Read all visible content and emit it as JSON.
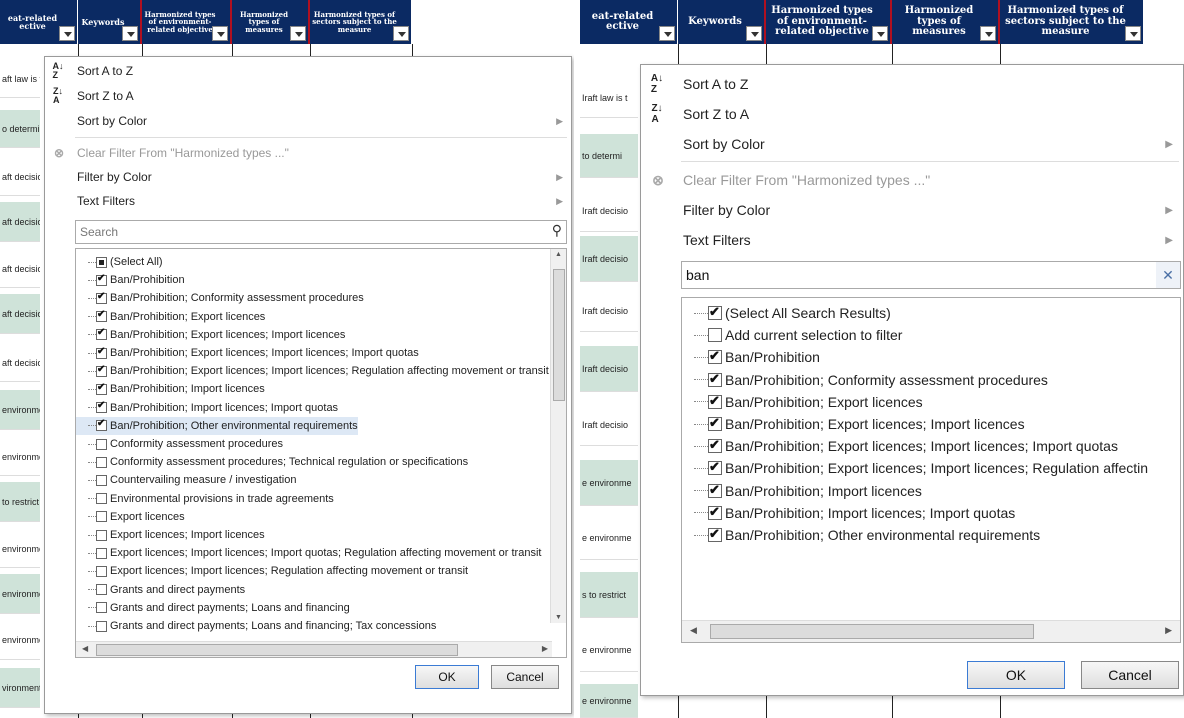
{
  "columns": [
    "eat-related ective",
    "Keywords",
    "Harmonized types of environment-related objective",
    "Harmonized types of measures",
    "Harmonized types of sectors subject to the measure"
  ],
  "left": {
    "rows": [
      "aft law is t",
      "o determi",
      "aft decisio",
      "aft decisio",
      "aft decisio",
      "aft decisio",
      "aft decisio",
      "environme",
      "environme",
      "to restrict",
      "environme",
      "environme",
      "environme",
      "vironment"
    ],
    "menu": {
      "sort_az": "Sort A to Z",
      "sort_za": "Sort Z to A",
      "sort_color": "Sort by Color",
      "clear": "Clear Filter From \"Harmonized types ...\"",
      "filter_color": "Filter by Color",
      "text_filters": "Text Filters",
      "search_placeholder": "Search",
      "items": [
        {
          "label": "(Select All)",
          "state": "partial"
        },
        {
          "label": "Ban/Prohibition",
          "state": "on"
        },
        {
          "label": "Ban/Prohibition; Conformity assessment procedures",
          "state": "on"
        },
        {
          "label": "Ban/Prohibition; Export licences",
          "state": "on"
        },
        {
          "label": "Ban/Prohibition; Export licences; Import licences",
          "state": "on"
        },
        {
          "label": "Ban/Prohibition; Export licences; Import licences; Import quotas",
          "state": "on"
        },
        {
          "label": "Ban/Prohibition; Export licences; Import licences; Regulation affecting movement or transit",
          "state": "on"
        },
        {
          "label": "Ban/Prohibition; Import licences",
          "state": "on"
        },
        {
          "label": "Ban/Prohibition; Import licences; Import quotas",
          "state": "on"
        },
        {
          "label": "Ban/Prohibition; Other environmental requirements",
          "state": "on"
        },
        {
          "label": "Conformity assessment procedures",
          "state": "off"
        },
        {
          "label": "Conformity assessment procedures; Technical regulation or specifications",
          "state": "off"
        },
        {
          "label": "Countervailing measure / investigation",
          "state": "off"
        },
        {
          "label": "Environmental provisions in trade agreements",
          "state": "off"
        },
        {
          "label": "Export licences",
          "state": "off"
        },
        {
          "label": "Export licences; Import licences",
          "state": "off"
        },
        {
          "label": "Export licences; Import licences; Import quotas; Regulation affecting movement or transit",
          "state": "off"
        },
        {
          "label": "Export licences; Import licences; Regulation affecting movement or transit",
          "state": "off"
        },
        {
          "label": "Grants and direct payments",
          "state": "off"
        },
        {
          "label": "Grants and direct payments; Loans and financing",
          "state": "off"
        },
        {
          "label": "Grants and direct payments; Loans and financing; Tax concessions",
          "state": "off"
        }
      ],
      "ok": "OK",
      "cancel": "Cancel"
    }
  },
  "right": {
    "rows": [
      "Iraft law is t",
      "to determi",
      "Iraft decisio",
      "Iraft decisio",
      "Iraft decisio",
      "Iraft decisio",
      "Iraft decisio",
      "e environme",
      "e environme",
      "s to restrict",
      "e environme",
      "e environme"
    ],
    "menu": {
      "sort_az": "Sort A to Z",
      "sort_za": "Sort Z to A",
      "sort_color": "Sort by Color",
      "clear": "Clear Filter From \"Harmonized types ...\"",
      "filter_color": "Filter by Color",
      "text_filters": "Text Filters",
      "search_value": "ban",
      "items": [
        {
          "label": "(Select All Search Results)",
          "state": "on"
        },
        {
          "label": "Add current selection to filter",
          "state": "off"
        },
        {
          "label": "Ban/Prohibition",
          "state": "on"
        },
        {
          "label": "Ban/Prohibition; Conformity assessment procedures",
          "state": "on"
        },
        {
          "label": "Ban/Prohibition; Export licences",
          "state": "on"
        },
        {
          "label": "Ban/Prohibition; Export licences; Import licences",
          "state": "on"
        },
        {
          "label": "Ban/Prohibition; Export licences; Import licences; Import quotas",
          "state": "on"
        },
        {
          "label": "Ban/Prohibition; Export licences; Import licences; Regulation affectin",
          "state": "on"
        },
        {
          "label": "Ban/Prohibition; Import licences",
          "state": "on"
        },
        {
          "label": "Ban/Prohibition; Import licences; Import quotas",
          "state": "on"
        },
        {
          "label": "Ban/Prohibition; Other environmental requirements",
          "state": "on"
        }
      ],
      "ok": "OK",
      "cancel": "Cancel"
    }
  },
  "icons": {
    "sort_az": "sort-ascending-icon",
    "sort_za": "sort-descending-icon",
    "clear": "clear-filter-icon",
    "search": "magnifier-icon",
    "clear_search": "close-icon"
  }
}
